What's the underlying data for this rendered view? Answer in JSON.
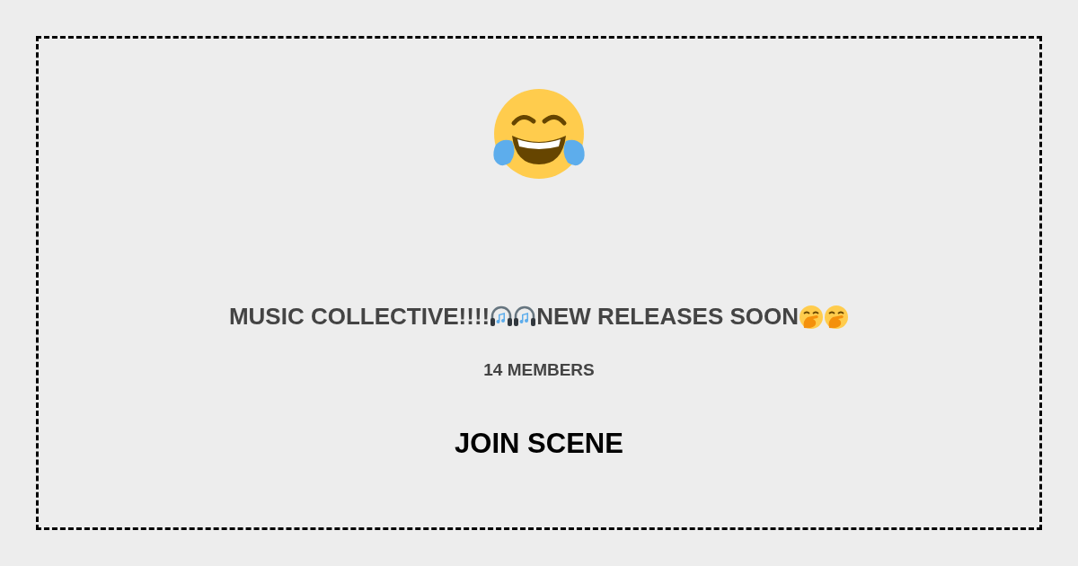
{
  "title": {
    "before": "MUSIC COLLECTIVE!!!!",
    "after": "NEW RELEASES SOON"
  },
  "members": "14 MEMBERS",
  "join_button": "JOIN SCENE"
}
